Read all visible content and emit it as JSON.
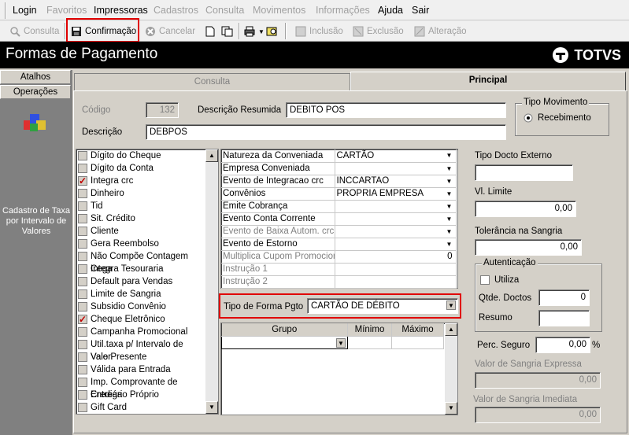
{
  "menu": [
    {
      "label": "Login",
      "enabled": true
    },
    {
      "label": "Favoritos",
      "enabled": false
    },
    {
      "label": "Impressoras",
      "enabled": true
    },
    {
      "label": "Cadastros",
      "enabled": false
    },
    {
      "label": "Consulta",
      "enabled": false
    },
    {
      "label": "Movimentos",
      "enabled": false
    },
    {
      "label": "Informações",
      "enabled": false
    },
    {
      "label": "Ajuda",
      "enabled": true
    },
    {
      "label": "Sair",
      "enabled": true
    }
  ],
  "toolbar": {
    "consulta": "Consulta",
    "confirmacao": "Confirmação",
    "cancelar": "Cancelar",
    "inclusao": "Inclusão",
    "exclusao": "Exclusão",
    "alteracao": "Alteração"
  },
  "title": "Formas de Pagamento",
  "brand": "TOTVS",
  "sidebar": {
    "atalhos": "Atalhos",
    "operacoes": "Operações",
    "shortcut": "Cadastro de Taxa por Intervalo de Valores"
  },
  "tabs": {
    "consulta": "Consulta",
    "principal": "Principal"
  },
  "form": {
    "codigo_label": "Código",
    "codigo_value": "132",
    "desc_resumida_label": "Descrição Resumida",
    "desc_resumida_value": "DEBITO POS",
    "descricao_label": "Descrição",
    "descricao_value": "DEBPOS",
    "tipo_movimento_label": "Tipo Movimento",
    "recebimento_label": "Recebimento"
  },
  "flags": [
    {
      "label": "Dígito do Cheque",
      "checked": false
    },
    {
      "label": "Dígito da Conta",
      "checked": false
    },
    {
      "label": "Integra crc",
      "checked": true
    },
    {
      "label": "Dinheiro",
      "checked": false
    },
    {
      "label": "Tid",
      "checked": false
    },
    {
      "label": "Sit. Crédito",
      "checked": false
    },
    {
      "label": "Cliente",
      "checked": false
    },
    {
      "label": "Gera Reembolso",
      "checked": false
    },
    {
      "label": "Não Compõe Contagem Cega",
      "checked": false
    },
    {
      "label": "Integra Tesouraria",
      "checked": false
    },
    {
      "label": "Default para Vendas",
      "checked": false
    },
    {
      "label": "Limite de Sangria",
      "checked": false
    },
    {
      "label": "Subsidio Convênio",
      "checked": false
    },
    {
      "label": "Cheque Eletrônico",
      "checked": true
    },
    {
      "label": "Campanha Promocional",
      "checked": false
    },
    {
      "label": "Util.taxa p/ Intervalo de Valor.",
      "checked": false
    },
    {
      "label": "Vale Presente",
      "checked": false
    },
    {
      "label": "Válida para Entrada",
      "checked": false
    },
    {
      "label": "Imp. Comprovante de Entrega",
      "checked": false
    },
    {
      "label": "Crediário Próprio",
      "checked": false
    },
    {
      "label": "Gift Card",
      "checked": false
    }
  ],
  "props": [
    {
      "label": "Natureza da Conveniada",
      "value": "CARTÃO",
      "enabled": true,
      "dropdown": true
    },
    {
      "label": "Empresa Conveniada",
      "value": "",
      "enabled": true,
      "dropdown": true
    },
    {
      "label": "Evento de Integracao crc",
      "value": "INCCARTAO",
      "enabled": true,
      "dropdown": true
    },
    {
      "label": "Convênios",
      "value": "PROPRIA EMPRESA",
      "enabled": true,
      "dropdown": true
    },
    {
      "label": "Emite Cobrança",
      "value": "",
      "enabled": true,
      "dropdown": true
    },
    {
      "label": "Evento Conta Corrente",
      "value": "",
      "enabled": true,
      "dropdown": true
    },
    {
      "label": "Evento de Baixa Autom. crc",
      "value": "",
      "enabled": false,
      "dropdown": true
    },
    {
      "label": "Evento de Estorno",
      "value": "",
      "enabled": true,
      "dropdown": true
    },
    {
      "label": "Multiplica Cupom Promocional",
      "value": "0",
      "enabled": false,
      "dropdown": false
    },
    {
      "label": "Instrução 1",
      "value": "",
      "enabled": false,
      "dropdown": false
    },
    {
      "label": "Instrução 2",
      "value": "",
      "enabled": false,
      "dropdown": false
    }
  ],
  "tipo_forma": {
    "label": "Tipo de Forma Pgto",
    "value": "CARTÃO DE DÉBITO"
  },
  "grupo_grid": {
    "headers": [
      "Grupo",
      "Mínimo",
      "Máximo"
    ]
  },
  "right": {
    "tipo_docto_label": "Tipo Docto Externo",
    "tipo_docto_value": "",
    "vl_limite_label": "Vl. Limite",
    "vl_limite_value": "0,00",
    "tolerancia_label": "Tolerância na Sangria",
    "tolerancia_value": "0,00",
    "autenticacao_label": "Autenticação",
    "utiliza_label": "Utiliza",
    "qtde_label": "Qtde. Doctos",
    "qtde_value": "0",
    "resumo_label": "Resumo",
    "resumo_value": "",
    "perc_label": "Perc. Seguro",
    "perc_value": "0,00",
    "perc_unit": "%",
    "sangria_expressa_label": "Valor de Sangria Expressa",
    "sangria_expressa_value": "0,00",
    "sangria_imediata_label": "Valor de Sangria Imediata",
    "sangria_imediata_value": "0,00"
  },
  "colors": {
    "highlight": "#e00000",
    "title_bg": "#000000",
    "check": "#c00000"
  }
}
